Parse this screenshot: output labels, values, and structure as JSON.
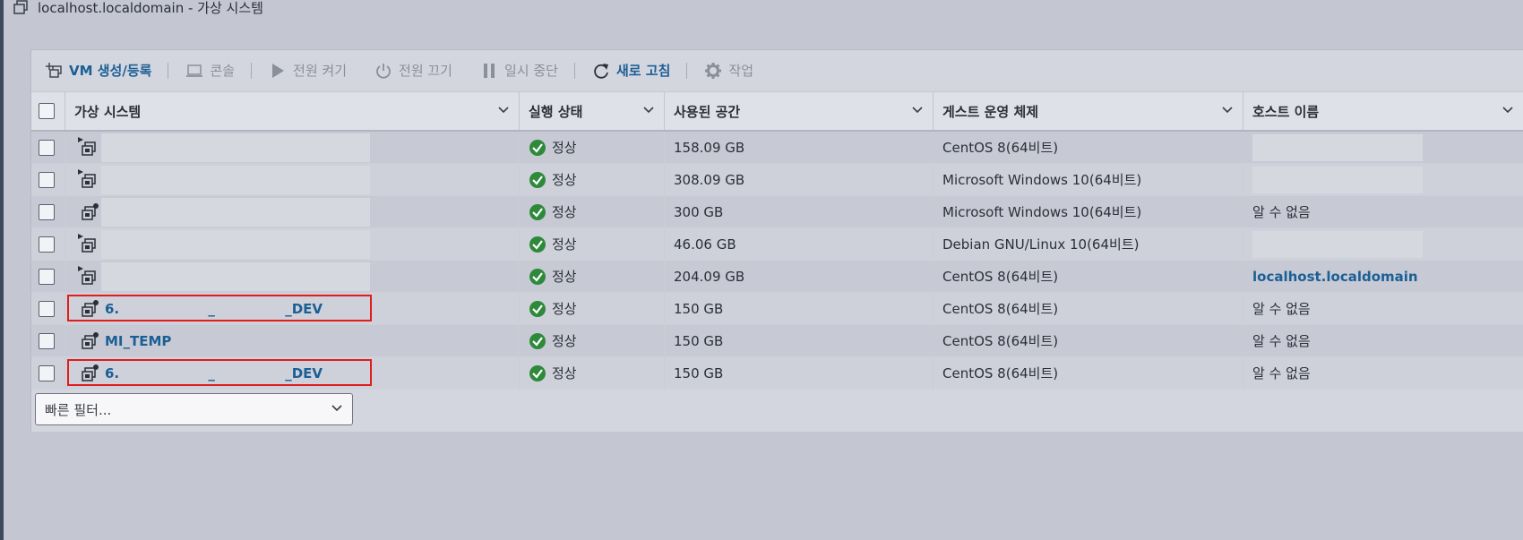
{
  "window": {
    "title": "localhost.localdomain - 가상 시스템"
  },
  "toolbar": {
    "create": "VM 생성/등록",
    "console": "콘솔",
    "power_on": "전원 켜기",
    "power_off": "전원 끄기",
    "suspend": "일시 중단",
    "refresh": "새로 고침",
    "actions": "작업"
  },
  "table": {
    "columns": [
      "가상 시스템",
      "실행 상태",
      "사용된 공간",
      "게스트 운영 체제",
      "호스트 이름"
    ],
    "rows": [
      {
        "name": "",
        "state": "정상",
        "space": "158.09 GB",
        "os": "CentOS 8(64비트)",
        "host": ""
      },
      {
        "name": "",
        "state": "정상",
        "space": "308.09 GB",
        "os": "Microsoft Windows 10(64비트)",
        "host": ""
      },
      {
        "name": "",
        "state": "정상",
        "space": "300 GB",
        "os": "Microsoft Windows 10(64비트)",
        "host": "알 수 없음"
      },
      {
        "name": "",
        "state": "정상",
        "space": "46.06 GB",
        "os": "Debian GNU/Linux 10(64비트)",
        "host": ""
      },
      {
        "name": "",
        "state": "정상",
        "space": "204.09 GB",
        "os": "CentOS 8(64비트)",
        "host": "localhost.localdomain"
      },
      {
        "name": "6.                   _               _DEV",
        "state": "정상",
        "space": "150 GB",
        "os": "CentOS 8(64비트)",
        "host": "알 수 없음"
      },
      {
        "name": "MI_TEMP",
        "state": "정상",
        "space": "150 GB",
        "os": "CentOS 8(64비트)",
        "host": "알 수 없음"
      },
      {
        "name": "6.                   _               _DEV",
        "state": "정상",
        "space": "150 GB",
        "os": "CentOS 8(64비트)",
        "host": "알 수 없음"
      }
    ]
  },
  "filter": {
    "placeholder": "빠른 필터..."
  },
  "colors": {
    "accent": "#1c5f95",
    "ok": "#2e8a3a",
    "highlight": "#e01c1c"
  }
}
